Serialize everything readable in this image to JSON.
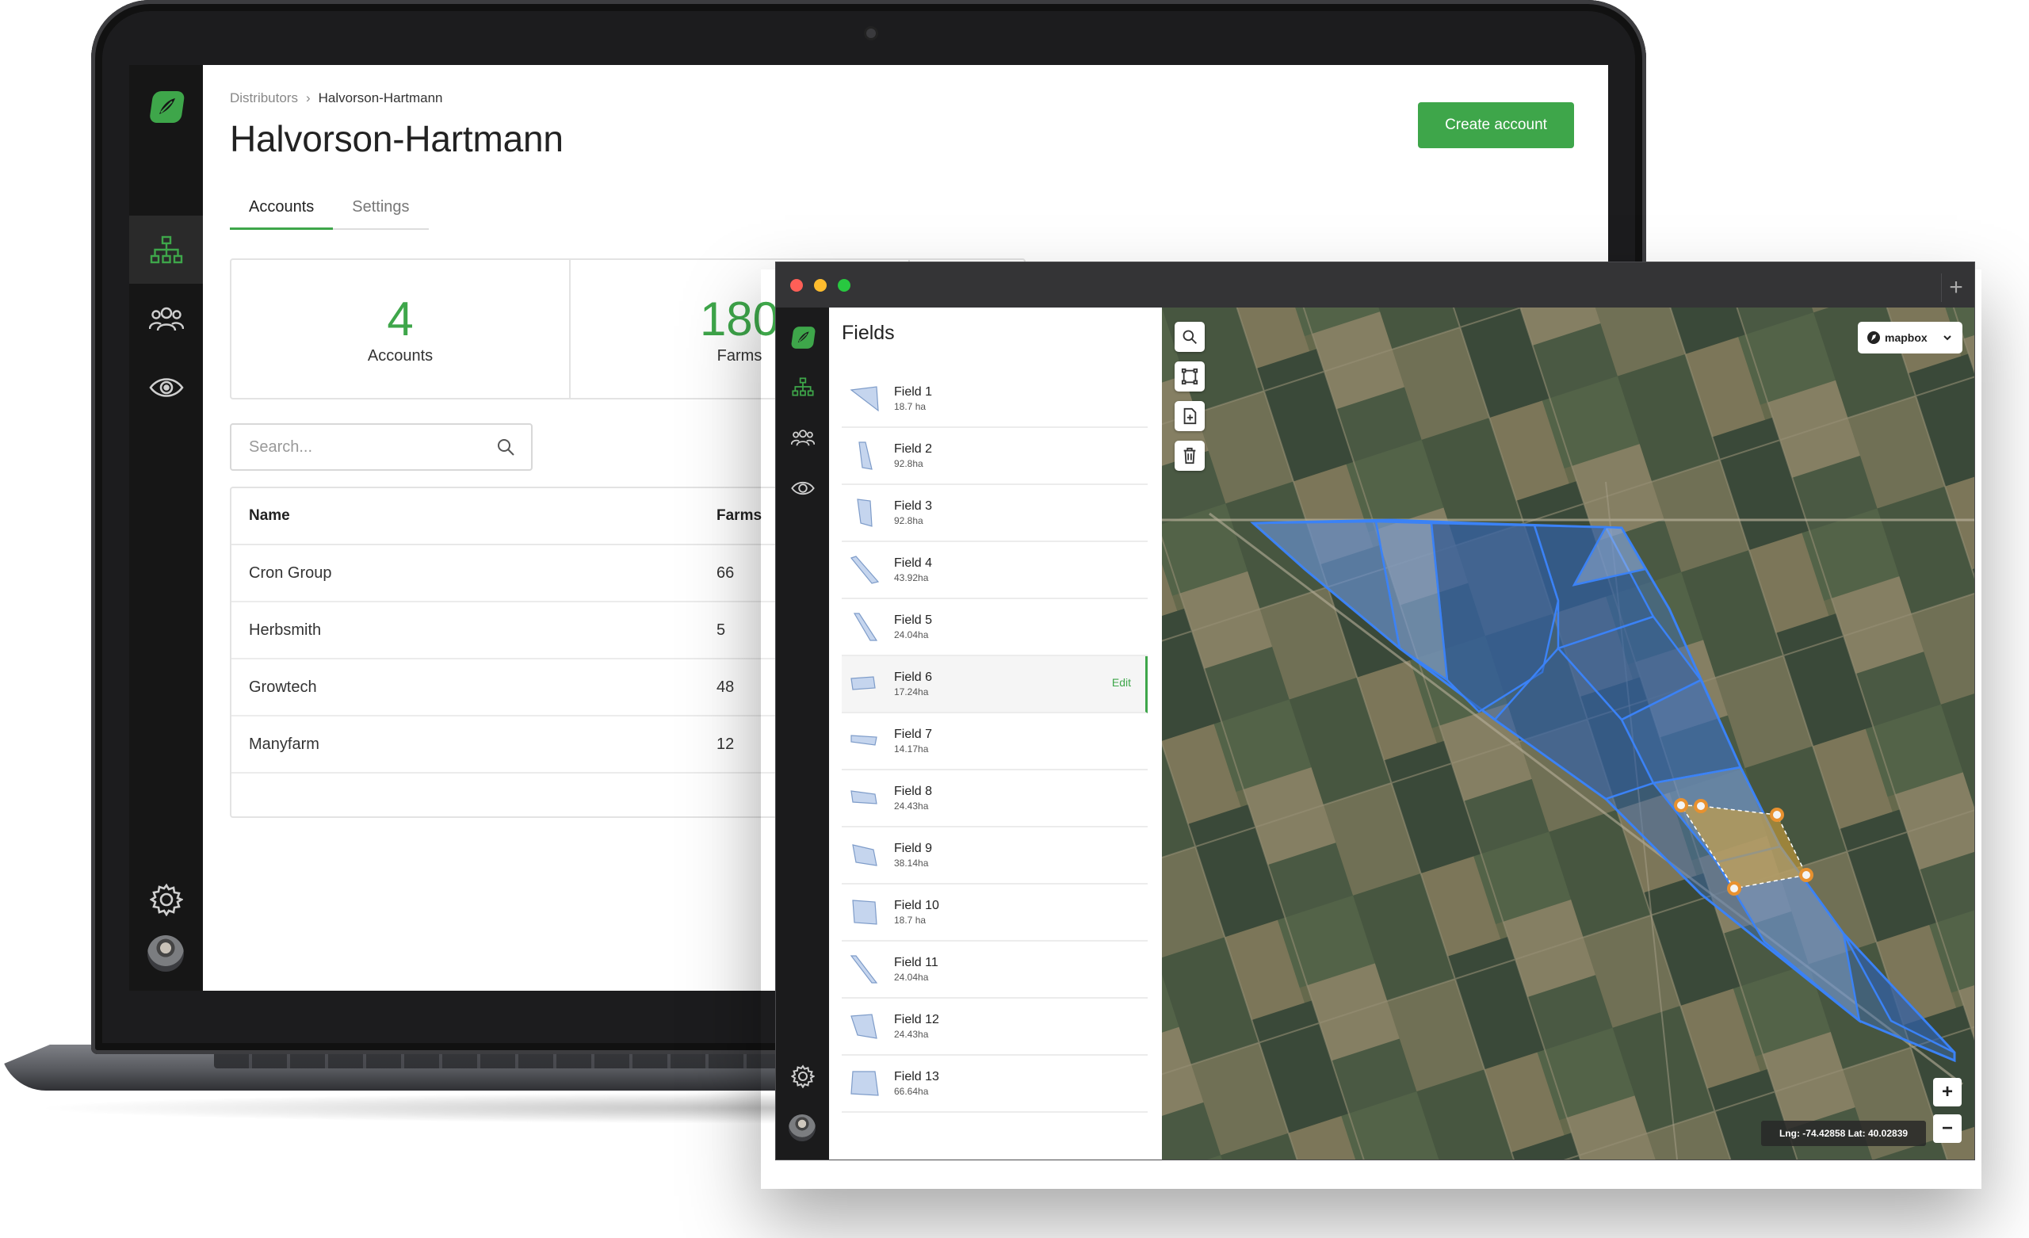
{
  "colors": {
    "accent": "#3ea64a",
    "sidebar": "#161616",
    "field_fill": "#3d6fb8",
    "field_stroke": "#3b82f6",
    "selection": "#e8912f"
  },
  "dashboard": {
    "breadcrumb": {
      "parent": "Distributors",
      "separator": "›",
      "current": "Halvorson-Hartmann"
    },
    "title": "Halvorson-Hartmann",
    "create_button": "Create account",
    "tabs": [
      {
        "label": "Accounts",
        "active": true
      },
      {
        "label": "Settings",
        "active": false
      }
    ],
    "stats": [
      {
        "value": "4",
        "label": "Accounts"
      },
      {
        "value": "180",
        "label": "Farms"
      }
    ],
    "search": {
      "placeholder": "Search..."
    },
    "table": {
      "columns": [
        "Name",
        "Farms"
      ],
      "rows": [
        {
          "name": "Cron Group",
          "farms": "66"
        },
        {
          "name": "Herbsmith",
          "farms": "5"
        },
        {
          "name": "Growtech",
          "farms": "48"
        },
        {
          "name": "Manyfarm",
          "farms": "12"
        }
      ]
    },
    "sidebar": [
      "org-tree-icon",
      "users-icon",
      "eye-icon",
      "gear-icon",
      "avatar"
    ]
  },
  "fields_window": {
    "title": "Fields",
    "items": [
      {
        "name": "Field 1",
        "area": "18.7 ha"
      },
      {
        "name": "Field 2",
        "area": "92.8ha"
      },
      {
        "name": "Field 3",
        "area": "92.8ha"
      },
      {
        "name": "Field 4",
        "area": "43.92ha"
      },
      {
        "name": "Field 5",
        "area": "24.04ha"
      },
      {
        "name": "Field 6",
        "area": "17.24ha",
        "selected": true,
        "action": "Edit"
      },
      {
        "name": "Field 7",
        "area": "14.17ha"
      },
      {
        "name": "Field 8",
        "area": "24.43ha"
      },
      {
        "name": "Field 9",
        "area": "38.14ha"
      },
      {
        "name": "Field 10",
        "area": "18.7 ha"
      },
      {
        "name": "Field 11",
        "area": "24.04ha"
      },
      {
        "name": "Field 12",
        "area": "24.43ha"
      },
      {
        "name": "Field 13",
        "area": "66.64ha"
      }
    ],
    "map": {
      "style_label": "mapbox",
      "tools": [
        "search-icon",
        "polygon-icon",
        "import-icon",
        "trash-icon"
      ],
      "zoom_in": "+",
      "zoom_out": "−",
      "coords": "Lng: -74.42858 Lat: 40.02839"
    }
  }
}
